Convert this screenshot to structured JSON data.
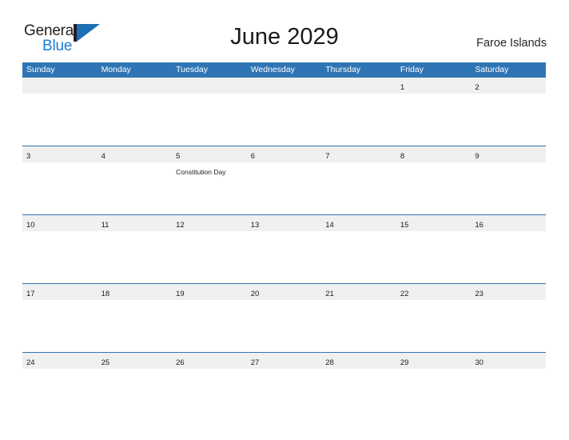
{
  "brand": {
    "name_part1": "General",
    "name_part2": "Blue",
    "mark": "triangle-flag-logo",
    "color_dark": "#231f20",
    "color_blue": "#1b7fd4"
  },
  "header": {
    "title": "June 2029",
    "region": "Faroe Islands"
  },
  "theme": {
    "header_blue": "#2f75b5",
    "rule_blue": "#2f75b5",
    "band_gray": "#f0f0f0",
    "text_dark": "#1a1a1a"
  },
  "weekdays": [
    "Sunday",
    "Monday",
    "Tuesday",
    "Wednesday",
    "Thursday",
    "Friday",
    "Saturday"
  ],
  "weeks": [
    [
      {
        "day": "",
        "event": ""
      },
      {
        "day": "",
        "event": ""
      },
      {
        "day": "",
        "event": ""
      },
      {
        "day": "",
        "event": ""
      },
      {
        "day": "",
        "event": ""
      },
      {
        "day": "1",
        "event": ""
      },
      {
        "day": "2",
        "event": ""
      }
    ],
    [
      {
        "day": "3",
        "event": ""
      },
      {
        "day": "4",
        "event": ""
      },
      {
        "day": "5",
        "event": "Constitution Day"
      },
      {
        "day": "6",
        "event": ""
      },
      {
        "day": "7",
        "event": ""
      },
      {
        "day": "8",
        "event": ""
      },
      {
        "day": "9",
        "event": ""
      }
    ],
    [
      {
        "day": "10",
        "event": ""
      },
      {
        "day": "11",
        "event": ""
      },
      {
        "day": "12",
        "event": ""
      },
      {
        "day": "13",
        "event": ""
      },
      {
        "day": "14",
        "event": ""
      },
      {
        "day": "15",
        "event": ""
      },
      {
        "day": "16",
        "event": ""
      }
    ],
    [
      {
        "day": "17",
        "event": ""
      },
      {
        "day": "18",
        "event": ""
      },
      {
        "day": "19",
        "event": ""
      },
      {
        "day": "20",
        "event": ""
      },
      {
        "day": "21",
        "event": ""
      },
      {
        "day": "22",
        "event": ""
      },
      {
        "day": "23",
        "event": ""
      }
    ],
    [
      {
        "day": "24",
        "event": ""
      },
      {
        "day": "25",
        "event": ""
      },
      {
        "day": "26",
        "event": ""
      },
      {
        "day": "27",
        "event": ""
      },
      {
        "day": "28",
        "event": ""
      },
      {
        "day": "29",
        "event": ""
      },
      {
        "day": "30",
        "event": ""
      }
    ]
  ]
}
